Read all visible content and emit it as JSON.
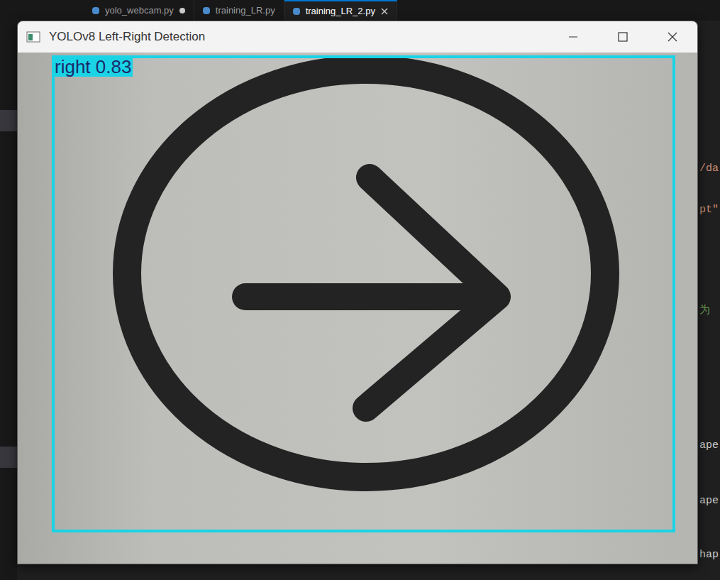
{
  "editor": {
    "tabs": [
      {
        "label": "yolo_webcam.py",
        "selected": false,
        "modified": true
      },
      {
        "label": "training_LR.py",
        "selected": false,
        "modified": false
      },
      {
        "label": "training_LR_2.py",
        "selected": true,
        "modified": false
      }
    ],
    "fragments": [
      "/da",
      "pt\"",
      "为",
      "ape",
      "ape",
      "hap"
    ]
  },
  "window": {
    "title": "YOLOv8 Left-Right Detection"
  },
  "detection": {
    "label": "right 0.83",
    "color": "#1ad4e6"
  }
}
